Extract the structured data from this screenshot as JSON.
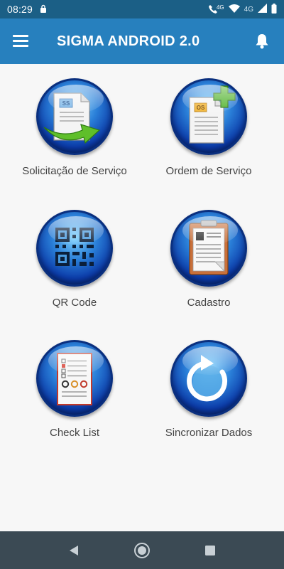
{
  "status_bar": {
    "time": "08:29",
    "network_label_1": "4G",
    "network_label_2": "4G"
  },
  "app_bar": {
    "title": "SIGMA ANDROID 2.0",
    "menu_icon": "hamburger-menu-icon",
    "bell_icon": "bell-icon"
  },
  "tiles": [
    {
      "label": "Solicitação de Serviço",
      "icon": "service-request-icon",
      "doc_code": "SS"
    },
    {
      "label": "Ordem de Serviço",
      "icon": "service-order-icon",
      "doc_code": "OS"
    },
    {
      "label": "QR Code",
      "icon": "qr-code-icon"
    },
    {
      "label": "Cadastro",
      "icon": "registration-clipboard-icon"
    },
    {
      "label": "Check List",
      "icon": "checklist-icon"
    },
    {
      "label": "Sincronizar Dados",
      "icon": "sync-icon"
    }
  ],
  "nav_bar": {
    "back_icon": "back-triangle-icon",
    "home_icon": "home-circle-icon",
    "recents_icon": "recents-square-icon"
  },
  "colors": {
    "status_bar": "#1b5f86",
    "app_bar": "#2780be",
    "nav_bar": "#3b4a54",
    "background": "#f7f7f7"
  }
}
